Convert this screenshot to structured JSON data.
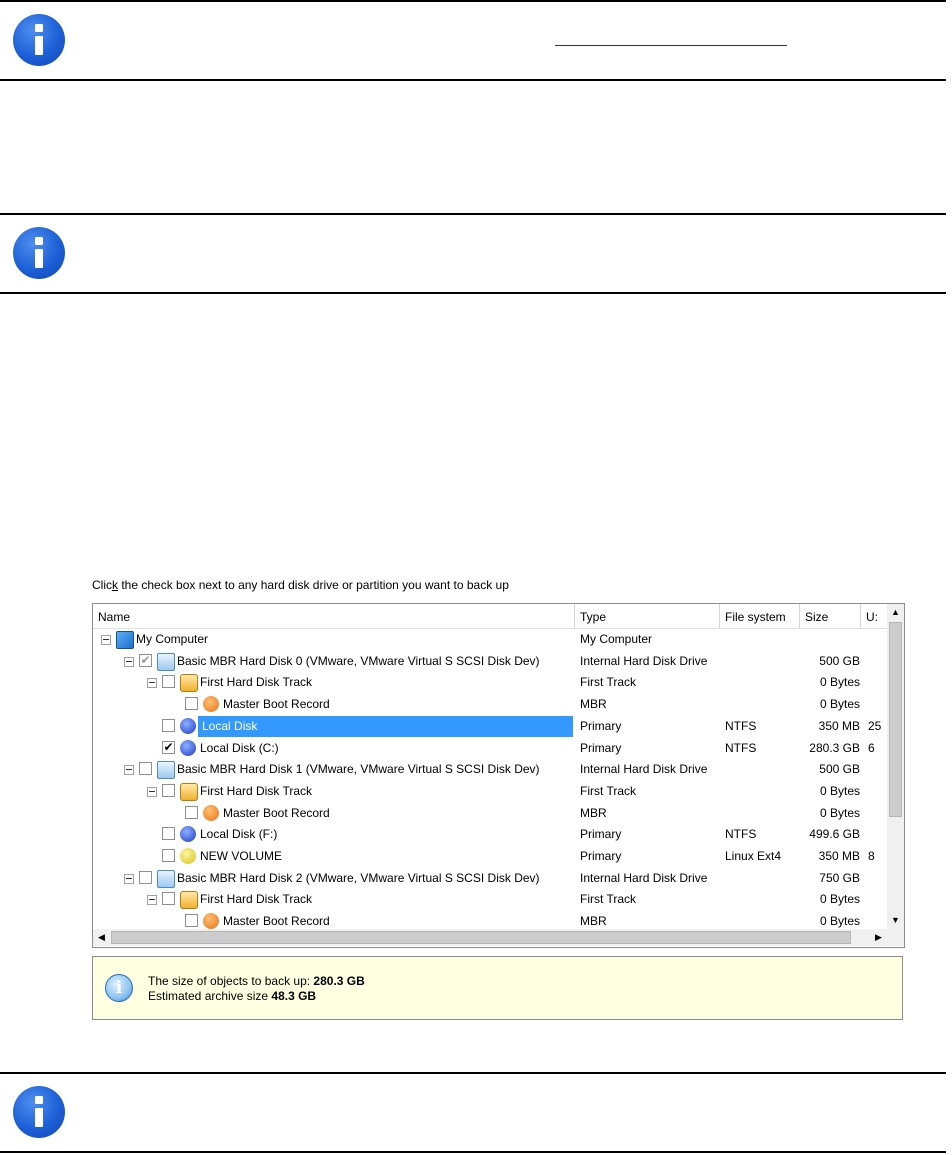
{
  "notes": [
    "info-icon",
    "info-icon",
    "info-icon"
  ],
  "backup": {
    "caption_pre": "Clic",
    "caption_key": "k",
    "caption_post": " the check box next to any hard disk drive or partition you want to back up",
    "columns": [
      "Name",
      "Type",
      "File system",
      "Size",
      "U:"
    ],
    "rows": [
      {
        "name": "My Computer",
        "type": "My Computer",
        "fs": "",
        "size": "",
        "used": "",
        "check": "none",
        "icon": "computer-icon"
      },
      {
        "name": "Basic MBR Hard Disk 0 (VMware, VMware Virtual S SCSI Disk Dev)",
        "type": "Internal Hard Disk Drive",
        "fs": "",
        "size": "500 GB",
        "used": "",
        "check": "partial",
        "icon": "hard-disk-icon"
      },
      {
        "name": "First Hard Disk Track",
        "type": "First Track",
        "fs": "",
        "size": "0 Bytes",
        "used": "",
        "check": "unchecked",
        "icon": "disk-track-icon"
      },
      {
        "name": "Master Boot Record",
        "type": "MBR",
        "fs": "",
        "size": "0 Bytes",
        "used": "",
        "check": "unchecked",
        "icon": "mbr-icon"
      },
      {
        "name": "Local Disk",
        "type": "Primary",
        "fs": "NTFS",
        "size": "350 MB",
        "used": "25",
        "check": "unchecked",
        "icon": "partition-icon",
        "selected": true
      },
      {
        "name": "Local Disk (C:)",
        "type": "Primary",
        "fs": "NTFS",
        "size": "280.3 GB",
        "used": "6",
        "check": "checked",
        "icon": "partition-icon"
      },
      {
        "name": "Basic MBR Hard Disk 1 (VMware, VMware Virtual S SCSI Disk Dev)",
        "type": "Internal Hard Disk Drive",
        "fs": "",
        "size": "500 GB",
        "used": "",
        "check": "unchecked",
        "icon": "hard-disk-icon"
      },
      {
        "name": "First Hard Disk Track",
        "type": "First Track",
        "fs": "",
        "size": "0 Bytes",
        "used": "",
        "check": "unchecked",
        "icon": "disk-track-icon"
      },
      {
        "name": "Master Boot Record",
        "type": "MBR",
        "fs": "",
        "size": "0 Bytes",
        "used": "",
        "check": "unchecked",
        "icon": "mbr-icon"
      },
      {
        "name": "Local Disk (F:)",
        "type": "Primary",
        "fs": "NTFS",
        "size": "499.6 GB",
        "used": "",
        "check": "unchecked",
        "icon": "partition-icon"
      },
      {
        "name": "NEW VOLUME",
        "type": "Primary",
        "fs": "Linux Ext4",
        "size": "350 MB",
        "used": "8",
        "check": "unchecked",
        "icon": "linux-volume-icon"
      },
      {
        "name": "Basic MBR Hard Disk 2 (VMware, VMware Virtual S SCSI Disk Dev)",
        "type": "Internal Hard Disk Drive",
        "fs": "",
        "size": "750 GB",
        "used": "",
        "check": "unchecked",
        "icon": "hard-disk-icon"
      },
      {
        "name": "First Hard Disk Track",
        "type": "First Track",
        "fs": "",
        "size": "0 Bytes",
        "used": "",
        "check": "unchecked",
        "icon": "disk-track-icon"
      },
      {
        "name": "Master Boot Record",
        "type": "MBR",
        "fs": "",
        "size": "0 Bytes",
        "used": "",
        "check": "unchecked",
        "icon": "mbr-icon"
      }
    ],
    "size_label": "The size of objects to back up: ",
    "size_value": "280.3 GB",
    "archive_label": "Estimated archive size ",
    "archive_value": "48.3 GB"
  }
}
